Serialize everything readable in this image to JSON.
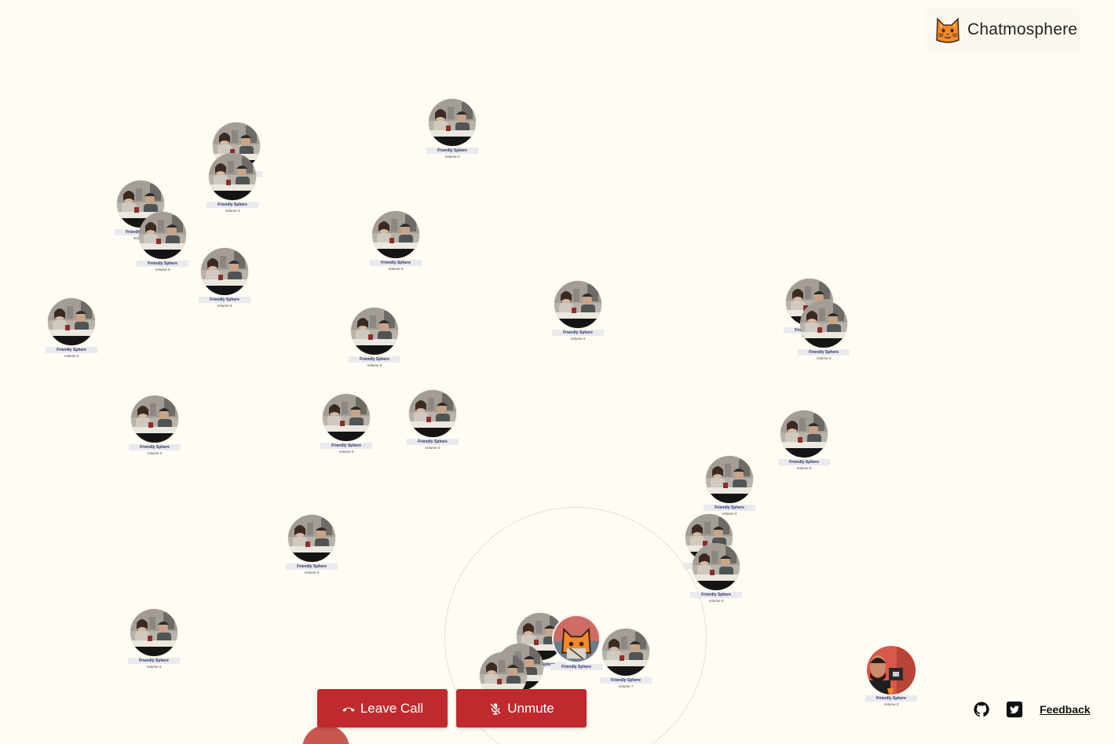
{
  "app": {
    "title": "Chatmosphere",
    "icon": "cat-face-icon"
  },
  "participant_defaults": {
    "name": "Friendly Sphere",
    "volume": "Volume 0"
  },
  "participants": [
    {
      "name": "Friendly Sphere",
      "volume": "Volume 0"
    },
    {
      "name": "Friendly Sphere",
      "volume": "Volume 0"
    },
    {
      "name": "Friendly Sphere",
      "volume": "Volume 0"
    },
    {
      "name": "Friendly Sphere",
      "volume": "Volume 0"
    },
    {
      "name": "Friendly Sphere",
      "volume": "Volume 0"
    },
    {
      "name": "Friendly Sphere",
      "volume": "Volume 0"
    },
    {
      "name": "Friendly Sphere",
      "volume": "Volume 0"
    },
    {
      "name": "Friendly Sphere",
      "volume": "Volume 0"
    },
    {
      "name": "Friendly Sphere",
      "volume": "Volume 0"
    },
    {
      "name": "Friendly Sphere",
      "volume": "Volume 0"
    },
    {
      "name": "Friendly Sphere",
      "volume": "Volume 0"
    },
    {
      "name": "Friendly Sphere",
      "volume": "Volume 0"
    },
    {
      "name": "Friendly Sphere",
      "volume": "Volume 0"
    },
    {
      "name": "Friendly Sphere",
      "volume": "Volume 0"
    },
    {
      "name": "Friendly Sphere",
      "volume": "Volume 0"
    },
    {
      "name": "Friendly Sphere",
      "volume": "Volume 0"
    },
    {
      "name": "Friendly Sphere",
      "volume": "Volume 0"
    },
    {
      "name": "Friendly Sphere",
      "volume": "Volume 0"
    },
    {
      "name": "Friendly Sphere",
      "volume": "Volume 0"
    },
    {
      "name": "Friendly Sphere",
      "volume": "Volume 0"
    },
    {
      "name": "Friendly Sphere",
      "volume": "Volume 0"
    },
    {
      "name": "Friendly Sphere",
      "volume": "Volume 0"
    },
    {
      "name": "Friendly Sphere",
      "volume": "Volume 0"
    },
    {
      "name": "Friendly Sphere",
      "volume": "Volume 0"
    },
    {
      "name": "Friendly Sphere",
      "volume": "Volume 7"
    }
  ],
  "self": {
    "name": "Friendly Sphere"
  },
  "host": {
    "name": "Friendly Sphere",
    "volume": "Volume 0"
  },
  "controls": {
    "leave_label": "Leave Call",
    "leave_icon": "phone-hangup-icon",
    "unmute_label": "Unmute",
    "unmute_icon": "mic-off-icon"
  },
  "footer": {
    "github_icon": "github-icon",
    "twitter_icon": "twitter-icon",
    "feedback_label": "Feedback"
  },
  "colors": {
    "background": "#fffcf4",
    "button": "#be2a2d",
    "name_tag": "#e9e9ee",
    "name_text": "#2a3360"
  }
}
